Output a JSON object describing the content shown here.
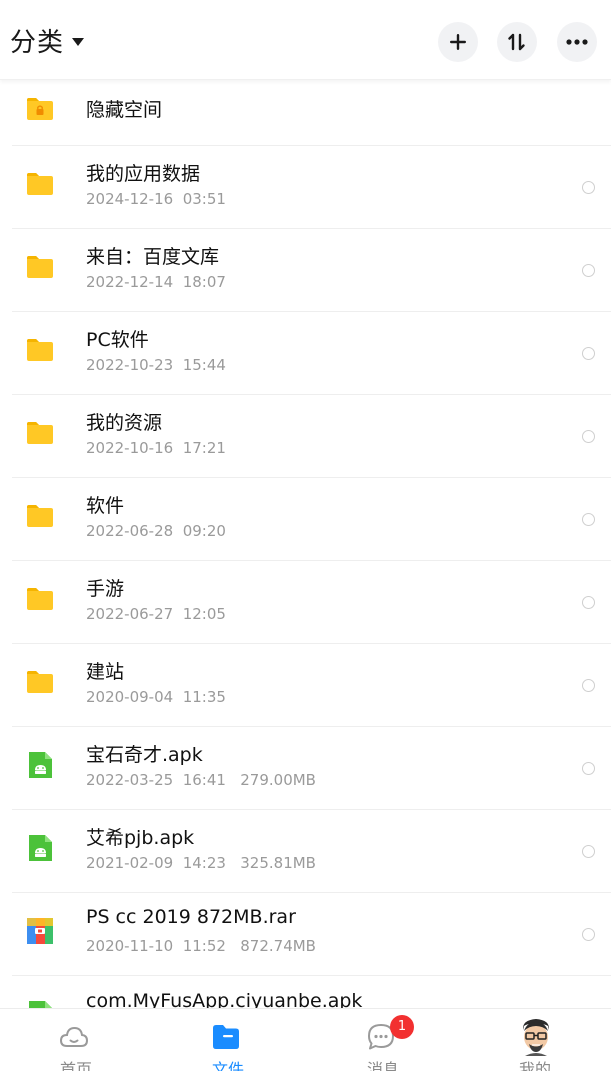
{
  "header": {
    "title": "分类"
  },
  "hidden_space": {
    "label": "隐藏空间"
  },
  "files": [
    {
      "name": "我的应用数据",
      "date": "2024-12-16  03:51",
      "size": "",
      "type": "folder"
    },
    {
      "name": "来自：百度文库",
      "date": "2022-12-14  18:07",
      "size": "",
      "type": "folder"
    },
    {
      "name": "PC软件",
      "date": "2022-10-23  15:44",
      "size": "",
      "type": "folder"
    },
    {
      "name": "我的资源",
      "date": "2022-10-16  17:21",
      "size": "",
      "type": "folder"
    },
    {
      "name": "软件",
      "date": "2022-06-28  09:20",
      "size": "",
      "type": "folder"
    },
    {
      "name": "手游",
      "date": "2022-06-27  12:05",
      "size": "",
      "type": "folder"
    },
    {
      "name": "建站",
      "date": "2020-09-04  11:35",
      "size": "",
      "type": "folder"
    },
    {
      "name": "宝石奇才.apk",
      "date": "2022-03-25  16:41",
      "size": "279.00MB",
      "type": "apk"
    },
    {
      "name": "艾希pjb.apk",
      "date": "2021-02-09  14:23",
      "size": "325.81MB",
      "type": "apk"
    },
    {
      "name": "PS cc 2019 872MB.rar",
      "date": "2020-11-10  11:52",
      "size": "872.74MB",
      "type": "rar"
    }
  ],
  "partial_file": {
    "name": "com.MyFusApp.ciyuanbe.apk",
    "type": "apk"
  },
  "bottom_nav": {
    "items": [
      {
        "label": "首页",
        "icon": "cloud-icon",
        "active": false
      },
      {
        "label": "文件",
        "icon": "folder-icon",
        "active": true
      },
      {
        "label": "消息",
        "icon": "chat-icon",
        "active": false,
        "badge": "1"
      },
      {
        "label": "我的",
        "icon": "avatar",
        "active": false
      }
    ]
  },
  "colors": {
    "folder": "#FFC825",
    "folder_tab": "#F5B400",
    "apk": "#4CC23A",
    "accent": "#1A8CFF",
    "badge": "#F23030"
  }
}
